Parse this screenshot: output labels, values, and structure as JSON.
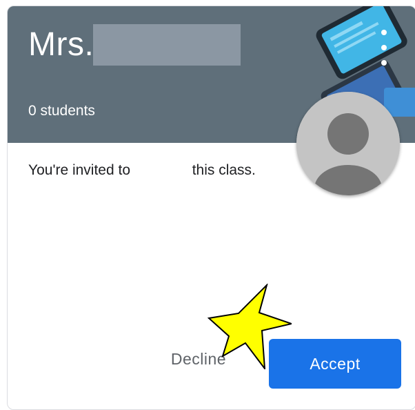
{
  "card": {
    "teacher_name": "Mrs.",
    "student_count": "0 students",
    "invite_prefix": "You're invited to",
    "invite_suffix": "this class.",
    "more_icon": "more-vert-icon",
    "avatar_icon": "person-silhouette-icon"
  },
  "actions": {
    "decline_label": "Decline",
    "accept_label": "Accept"
  },
  "annotation": {
    "icon": "star-icon",
    "fill_color": "#ffff00"
  },
  "colors": {
    "header_bg": "#5f6f7a",
    "accent": "#1a73e8",
    "avatar_bg": "#c4c4c4",
    "avatar_fg": "#757575"
  }
}
